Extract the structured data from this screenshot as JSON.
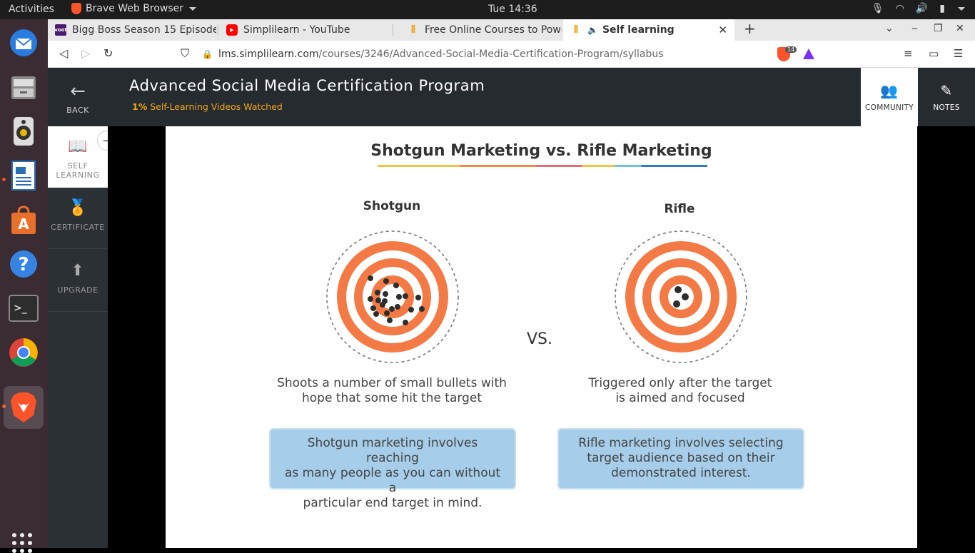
{
  "system": {
    "activities": "Activities",
    "app_name": "Brave Web Browser",
    "clock": "Tue 14:36"
  },
  "tabs": [
    {
      "label": "Bigg Boss Season 15 Episode",
      "favicon": "voot"
    },
    {
      "label": "Simplilearn - YouTube",
      "favicon": "youtube-icon"
    },
    {
      "label": "Free Online Courses to Power",
      "favicon": "simplilearn-icon"
    },
    {
      "label": "Self learning",
      "favicon": "simplilearn-icon",
      "active": true
    }
  ],
  "browser": {
    "url_host": "lms.simplilearn.com",
    "url_path": "/courses/3246/Advanced-Social-Media-Certification-Program/syllabus",
    "shield_count": "14"
  },
  "header": {
    "back": "BACK",
    "title": "Advanced Social Media Certification Program",
    "progress_pct": "1%",
    "progress_text": "Self-Learning Videos Watched",
    "community": "COMMUNITY",
    "notes": "NOTES"
  },
  "nav": {
    "self_learning_1": "SELF",
    "self_learning_2": "LEARNING",
    "certificate": "CERTIFICATE",
    "upgrade": "UPGRADE"
  },
  "slide": {
    "title": "Shotgun Marketing vs. Rifle Marketing",
    "left_label": "Shotgun",
    "right_label": "Rifle",
    "vs": "VS.",
    "left_desc_1": "Shoots a number of small bullets with",
    "left_desc_2": "hope that some hit the target",
    "right_desc_1": "Triggered only after the target",
    "right_desc_2": "is aimed and focused",
    "left_box_1": "Shotgun marketing involves reaching",
    "left_box_2": "as many people as you can without a",
    "left_box_3": "particular end target in mind.",
    "right_box_1": "Rifle marketing involves selecting",
    "right_box_2": "target audience based on their",
    "right_box_3": "demonstrated interest."
  },
  "colors": {
    "target_orange": "#f47a45",
    "accent_orange": "#f2a71b",
    "box_blue": "#a6cde9"
  }
}
